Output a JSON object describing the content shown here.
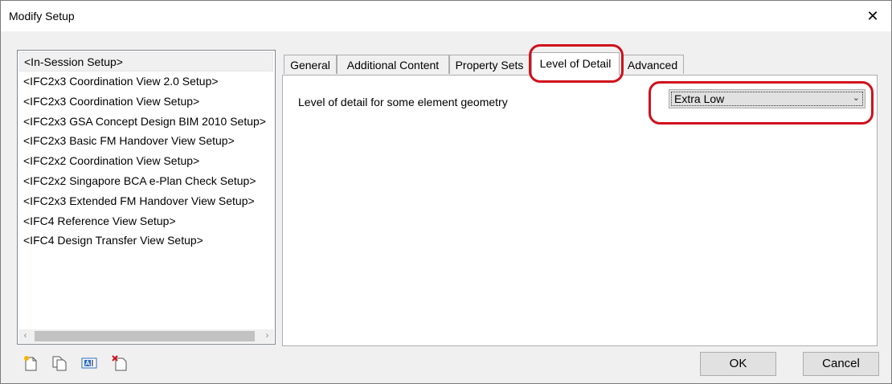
{
  "window": {
    "title": "Modify Setup",
    "close_glyph": "✕"
  },
  "setup_list": {
    "items": [
      "<In-Session Setup>",
      "<IFC2x3 Coordination View 2.0 Setup>",
      "<IFC2x3 Coordination View Setup>",
      "<IFC2x3 GSA Concept Design BIM 2010 Setup>",
      "<IFC2x3 Basic FM Handover View Setup>",
      "<IFC2x2 Coordination View Setup>",
      "<IFC2x2 Singapore BCA e-Plan Check Setup>",
      "<IFC2x3 Extended FM Handover View Setup>",
      "<IFC4 Reference View Setup>",
      "<IFC4 Design Transfer View Setup>"
    ],
    "selected_index": 0,
    "scroll_left_glyph": "‹",
    "scroll_right_glyph": "›"
  },
  "tabs": [
    {
      "label": "General"
    },
    {
      "label": "Additional Content"
    },
    {
      "label": "Property Sets"
    },
    {
      "label": "Level of Detail"
    },
    {
      "label": "Advanced"
    }
  ],
  "active_tab": "Level of Detail",
  "level_of_detail": {
    "label": "Level of detail for some element geometry",
    "selected_value": "Extra Low",
    "chevron_glyph": "⌄"
  },
  "toolbar_icons": [
    "new-setup-icon",
    "duplicate-setup-icon",
    "rename-setup-icon",
    "delete-setup-icon"
  ],
  "buttons": {
    "ok": "OK",
    "cancel": "Cancel"
  },
  "colors": {
    "highlight": "#d0101c",
    "window_bg": "#f0f0f0"
  }
}
